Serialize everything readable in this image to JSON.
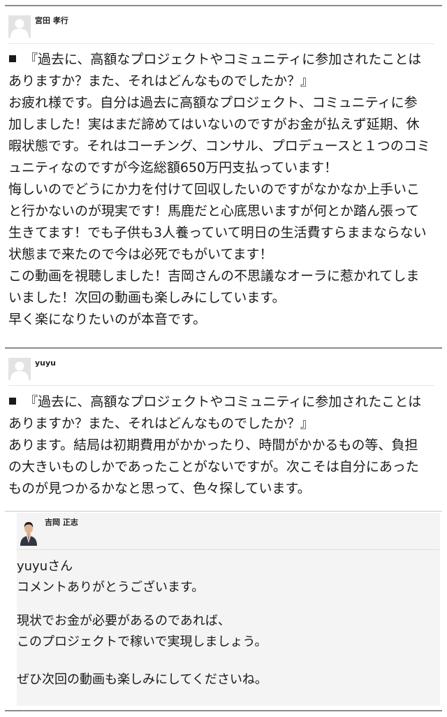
{
  "comments": [
    {
      "author": "宮田 孝行",
      "avatar_icon": "default-user-avatar-icon",
      "question": [
        "『過去に、高額なプロジェクトやコミュニティに参加されたことは",
        "ありますか？また、それはどんなものでしたか？』"
      ],
      "body": [
        "お疲れ様です。自分は過去に高額なプロジェクト、コミュニティに参",
        "加しました！実はまだ諦めてはいないのですがお金が払えず延期、休",
        "暇状態です。それはコーチング、コンサル、プロデュースと１つのコミ",
        "ュニティなのですが今迄総額650万円支払っています！",
        "悔しいのでどうにか力を付けて回収したいのですがなかなか上手いこ",
        "と行かないのが現実です！馬鹿だと心底思いますが何とか踏ん張って",
        "生きてます！でも子供も3人養っていて明日の生活費すらままならない",
        "状態まで来たので今は必死でもがいてます！",
        "この動画を視聴しました！吉岡さんの不思議なオーラに惹かれてしま",
        "いました！次回の動画も楽しみにしています。",
        "早く楽になりたいのが本音です。"
      ]
    },
    {
      "author": "yuyu",
      "avatar_icon": "default-user-avatar-icon",
      "question": [
        "『過去に、高額なプロジェクトやコミュニティに参加されたことは",
        "ありますか？また、それはどんなものでしたか？』"
      ],
      "body": [
        "あります。結局は初期費用がかかったり、時間がかかるもの等、負担",
        "の大きいものしかであったことがないですが。次こそは自分にあった",
        "ものが見つかるかなと思って、色々探しています。"
      ]
    }
  ],
  "reply": {
    "author": "吉岡 正志",
    "avatar_icon": "author-photo-avatar-icon",
    "paragraphs": [
      [
        "yuyuさん",
        "コメントありがとうございます。"
      ],
      [
        "現状でお金が必要があるのであれば、",
        "このプロジェクトで稼いで実現しましょう。"
      ],
      [
        "ぜひ次回の動画も楽しみにしてくださいね。"
      ]
    ]
  },
  "colors": {
    "divider": "#8c8c8c",
    "reply_background": "#f4f4f4",
    "text": "#1a1a1a"
  }
}
